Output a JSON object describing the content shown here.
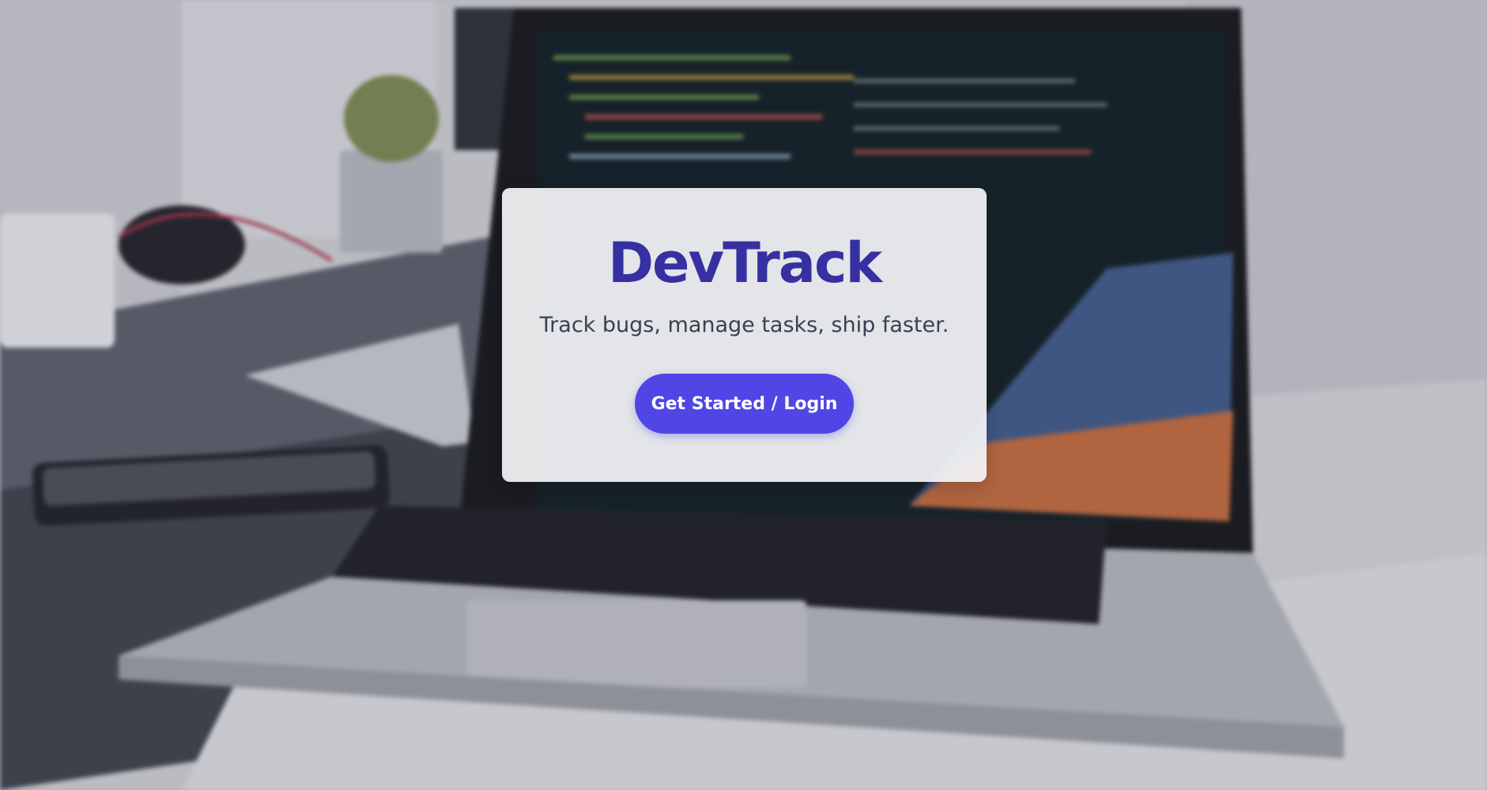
{
  "colors": {
    "brand": "#3730a3",
    "button": "#4f46e5",
    "tagline": "#374151"
  },
  "hero": {
    "title": "DevTrack",
    "tagline": "Track bugs, manage tasks, ship faster.",
    "cta_label": "Get Started / Login"
  }
}
